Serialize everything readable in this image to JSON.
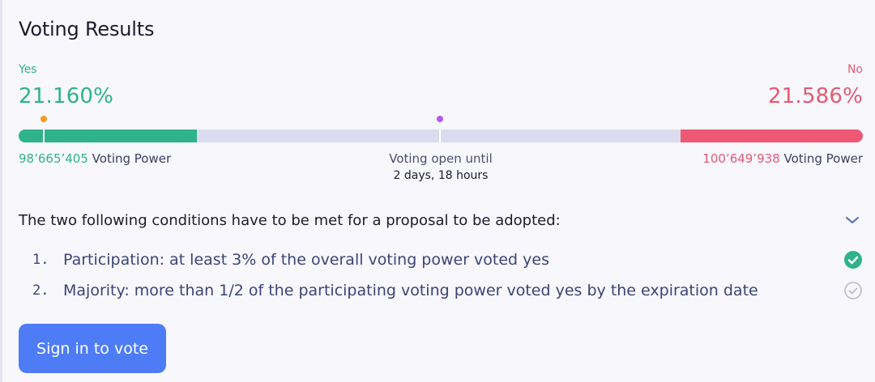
{
  "header": {
    "title": "Voting Results"
  },
  "results": {
    "yes_label": "Yes",
    "no_label": "No",
    "yes_percent": "21.160%",
    "no_percent": "21.586%",
    "yes_share": 0.2116,
    "no_share": 0.21586,
    "yes_voting_power": "98’665’405",
    "no_voting_power": "100’649’938",
    "voting_power_label": "Voting Power"
  },
  "deadline": {
    "label": "Voting open until",
    "remaining": "2 days, 18 hours"
  },
  "conditions": {
    "heading": "The two following conditions have to be met for a proposal to be adopted:",
    "items": [
      {
        "index": "1.",
        "text": "Participation: at least 3% of the overall voting power voted yes",
        "met": true
      },
      {
        "index": "2.",
        "text": "Majority: more than 1/2 of the participating voting power voted yes by the expiration date",
        "met": false
      }
    ]
  },
  "actions": {
    "sign_in_label": "Sign in to vote"
  },
  "colors": {
    "yes": "#2fb38a",
    "no": "#ef5874",
    "accent": "#4d7cf6",
    "track": "#dcdcf0"
  }
}
